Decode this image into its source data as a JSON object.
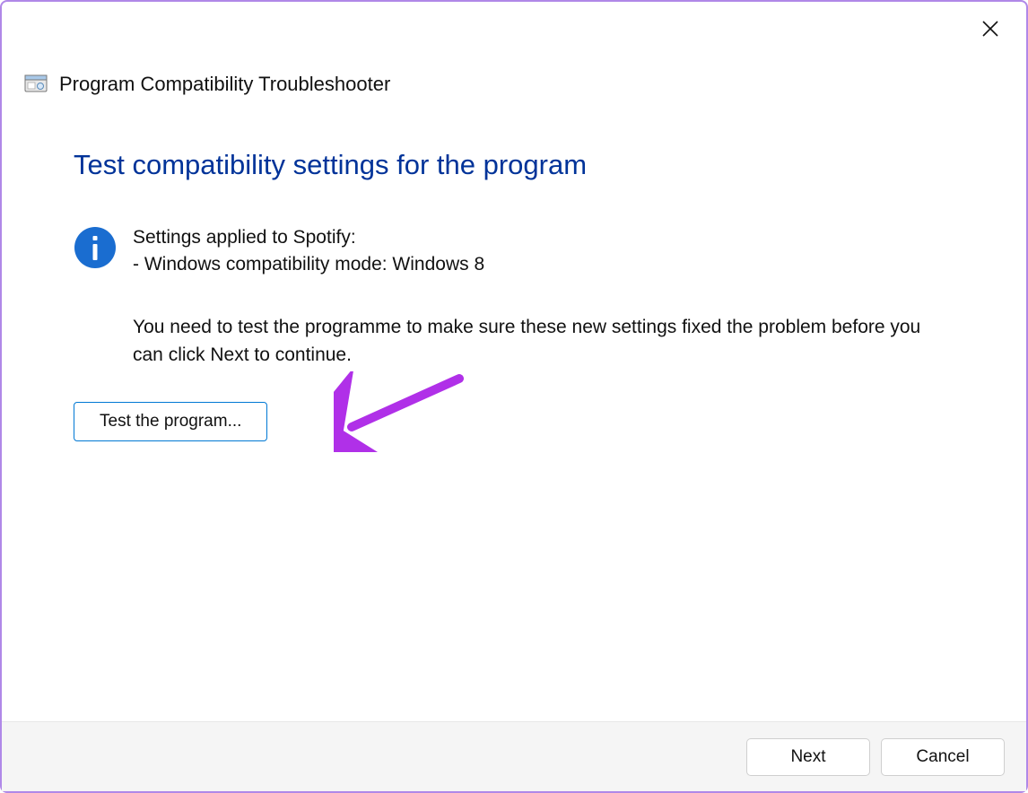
{
  "window": {
    "title": "Program Compatibility Troubleshooter"
  },
  "page": {
    "heading": "Test compatibility settings for the program",
    "settings_applied_label": "Settings applied to Spotify:",
    "settings_applied_detail": "- Windows compatibility mode: Windows 8",
    "instruction": "You need to test the programme to make sure these new settings fixed the problem before you can click Next to continue.",
    "test_button": "Test the program..."
  },
  "footer": {
    "next": "Next",
    "cancel": "Cancel"
  }
}
